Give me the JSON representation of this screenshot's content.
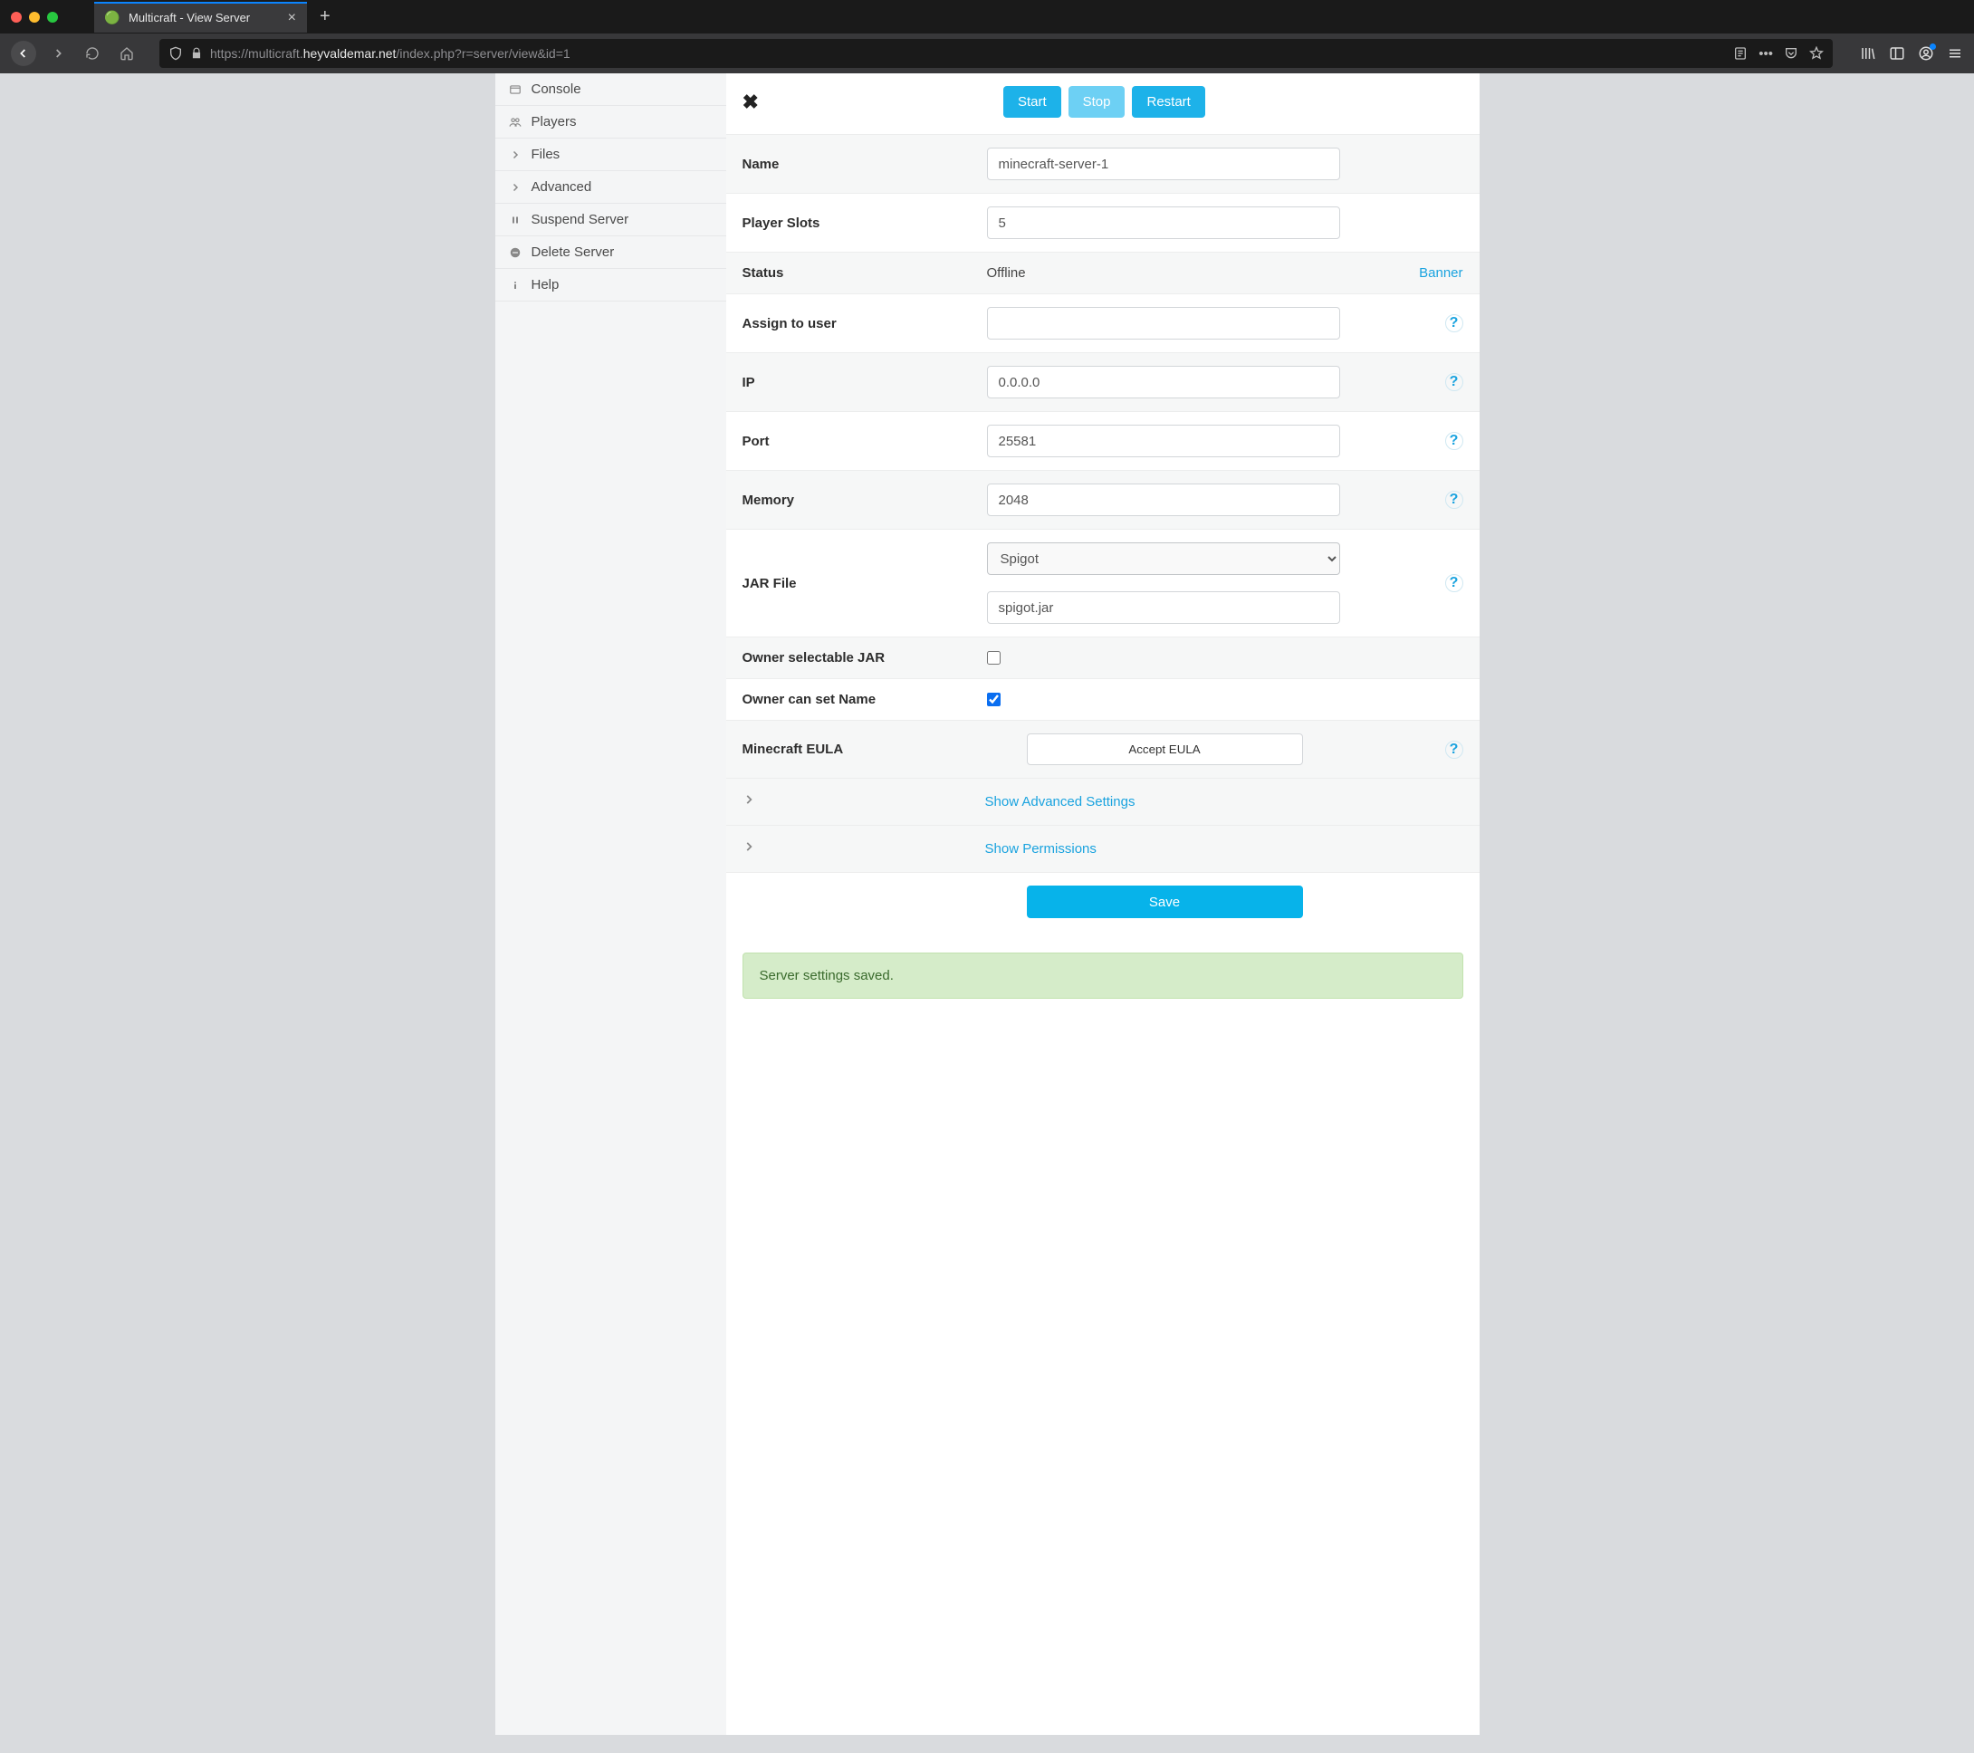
{
  "browser": {
    "tab_title": "Multicraft - View Server",
    "url_scheme": "https://",
    "url_sub": "multicraft.",
    "url_host": "heyvaldemar.net",
    "url_path": "/index.php?r=server/view&id=1"
  },
  "sidebar": {
    "items": [
      {
        "label": "Console",
        "icon": "console"
      },
      {
        "label": "Players",
        "icon": "players"
      },
      {
        "label": "Files",
        "icon": "files"
      },
      {
        "label": "Advanced",
        "icon": "advanced"
      },
      {
        "label": "Suspend Server",
        "icon": "suspend"
      },
      {
        "label": "Delete Server",
        "icon": "delete"
      },
      {
        "label": "Help",
        "icon": "help"
      }
    ]
  },
  "actions": {
    "start": "Start",
    "stop": "Stop",
    "restart": "Restart"
  },
  "form": {
    "name": {
      "label": "Name",
      "value": "minecraft-server-1"
    },
    "player_slots": {
      "label": "Player Slots",
      "value": "5"
    },
    "status": {
      "label": "Status",
      "value": "Offline",
      "banner": "Banner"
    },
    "assign_user": {
      "label": "Assign to user",
      "value": ""
    },
    "ip": {
      "label": "IP",
      "value": "0.0.0.0"
    },
    "port": {
      "label": "Port",
      "value": "25581"
    },
    "memory": {
      "label": "Memory",
      "value": "2048"
    },
    "jar_file": {
      "label": "JAR File",
      "select": "Spigot",
      "value": "spigot.jar"
    },
    "owner_jar": {
      "label": "Owner selectable JAR",
      "checked": false
    },
    "owner_name": {
      "label": "Owner can set Name",
      "checked": true
    },
    "eula": {
      "label": "Minecraft EULA",
      "button": "Accept EULA"
    },
    "adv": "Show Advanced Settings",
    "perms": "Show Permissions",
    "save": "Save"
  },
  "alert": "Server settings saved."
}
